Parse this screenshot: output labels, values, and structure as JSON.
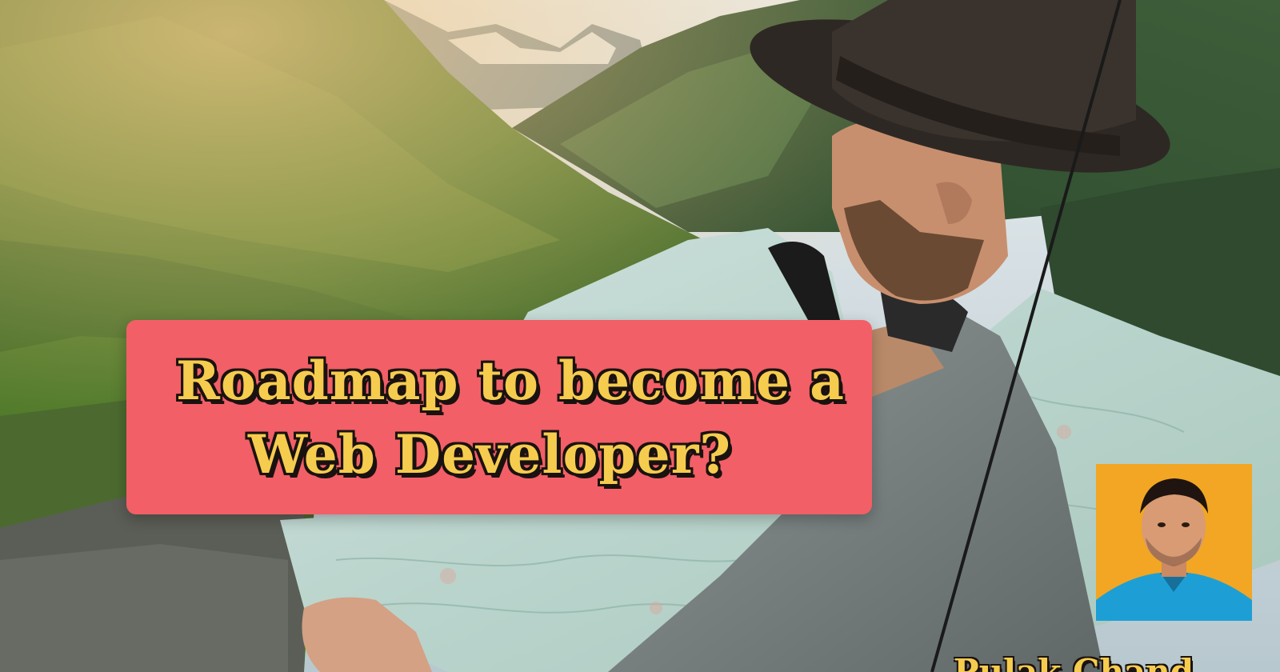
{
  "title": {
    "line1": "Roadmap to become a",
    "line2": "Web Developer?"
  },
  "author": {
    "name": "Pulak Chand"
  },
  "colors": {
    "card": "#f25f66",
    "title_text": "#f6cc4f",
    "title_outline": "#1a1210",
    "photo_background": "#f2a623",
    "shirt": "#1d9fd6"
  }
}
